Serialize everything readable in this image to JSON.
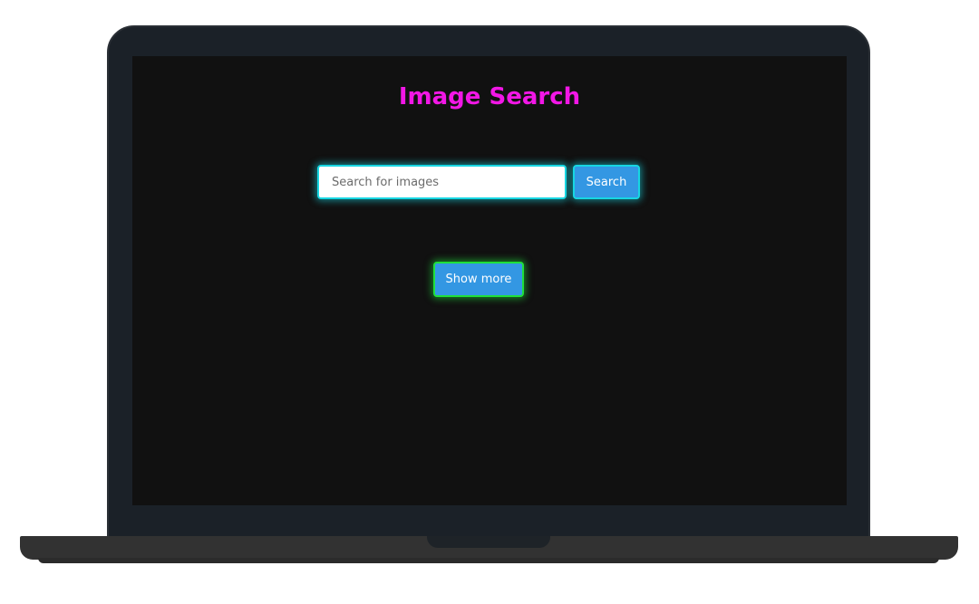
{
  "app": {
    "title": "Image Search"
  },
  "search": {
    "placeholder": "Search for images",
    "value": "",
    "button_label": "Search"
  },
  "results": {
    "show_more_label": "Show more"
  },
  "colors": {
    "title": "#f217e6",
    "screen_background": "#111111",
    "button_fill": "#3397e3",
    "search_glow": "#17d6e2",
    "show_more_glow": "#1fe03a",
    "bezel": "#1b2128",
    "laptop_base": "#323232"
  }
}
